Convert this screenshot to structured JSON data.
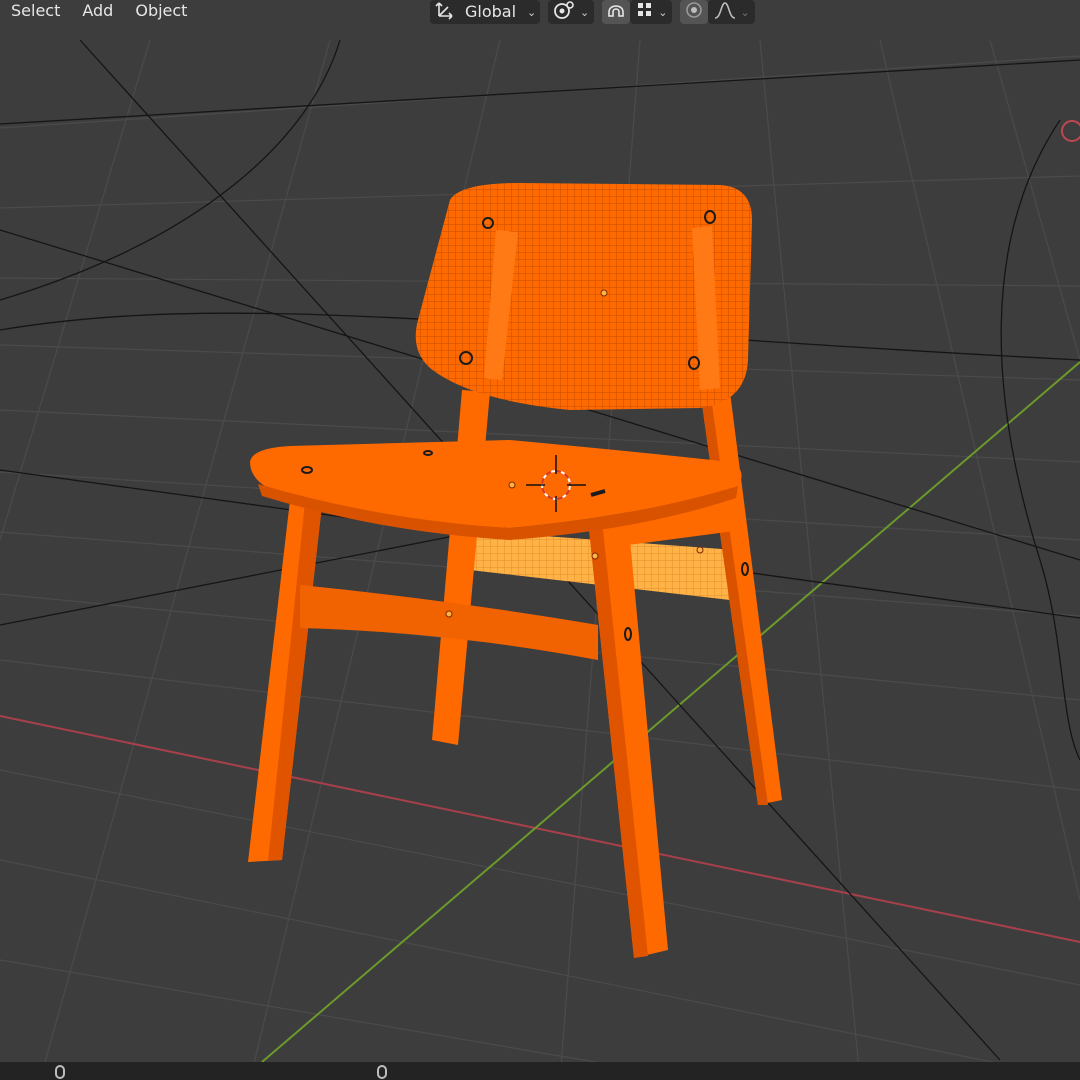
{
  "menu": {
    "items": [
      {
        "label": "Select"
      },
      {
        "label": "Add"
      },
      {
        "label": "Object"
      }
    ]
  },
  "toolbar": {
    "orientation_label": "Global",
    "icons": {
      "orientation": "transform-orientation-icon",
      "pivot": "pivot-point-icon",
      "snap": "snap-magnet-icon",
      "snap_target": "snap-increment-icon",
      "proportional": "proportional-editing-icon",
      "falloff": "falloff-curve-icon"
    }
  },
  "colors": {
    "background": "#3d3d3d",
    "grid": "#4a4a4a",
    "x_axis": "#a8404b",
    "y_axis": "#6b9a2b",
    "selection": "#ff6a00",
    "selection_dark": "#e05400",
    "selection_light": "#ffb347"
  },
  "statusbar": {
    "icons": [
      "mouse-left-icon",
      "mouse-middle-icon"
    ]
  }
}
